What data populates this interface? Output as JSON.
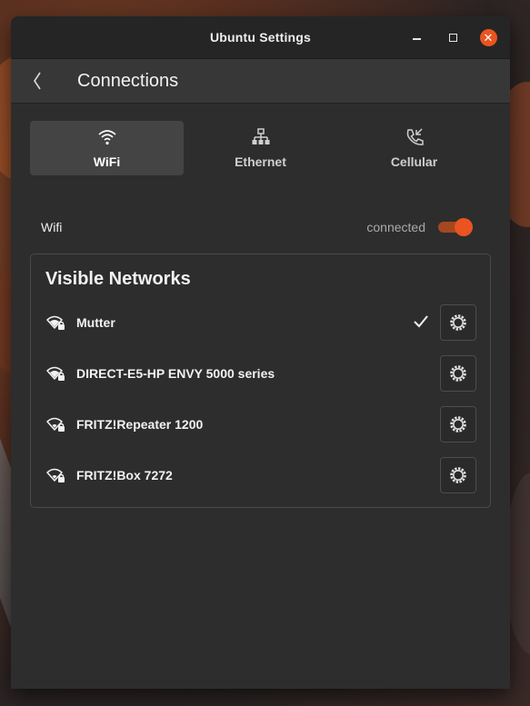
{
  "window": {
    "title": "Ubuntu Settings",
    "controls": {
      "minimize": "minimize-icon",
      "maximize": "maximize-icon",
      "close": "close-icon"
    }
  },
  "header": {
    "back_icon": "chevron-left-icon",
    "title": "Connections"
  },
  "tabs": [
    {
      "label": "WiFi",
      "icon": "wifi-icon",
      "active": true
    },
    {
      "label": "Ethernet",
      "icon": "network-wired-icon",
      "active": false
    },
    {
      "label": "Cellular",
      "icon": "phone-icon",
      "active": false
    }
  ],
  "wifi": {
    "label": "Wifi",
    "status": "connected",
    "enabled": true
  },
  "networks": {
    "title": "Visible Networks",
    "items": [
      {
        "name": "Mutter",
        "connected": true,
        "secured": true
      },
      {
        "name": "DIRECT-E5-HP ENVY 5000 series",
        "connected": false,
        "secured": true
      },
      {
        "name": "FRITZ!Repeater 1200",
        "connected": false,
        "secured": true
      },
      {
        "name": "FRITZ!Box 7272",
        "connected": false,
        "secured": true
      }
    ]
  },
  "colors": {
    "accent": "#e95420",
    "window_bg": "#2d2d2d",
    "header_bg": "#373737"
  }
}
